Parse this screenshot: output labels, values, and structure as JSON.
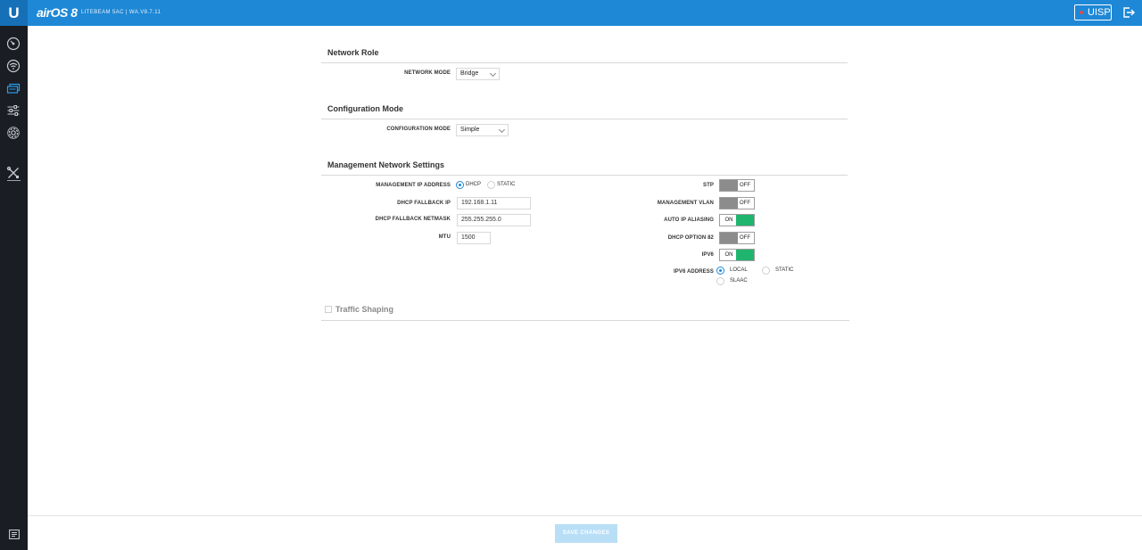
{
  "header": {
    "logo": "U",
    "brand": "airOS 8",
    "device": "LITEBEAM 5AC | WA.V8.7.11",
    "uisp_label": "UISP",
    "uisp_status_color": "#e24b4b",
    "accent": "#1e88d6"
  },
  "sidebar": {
    "items": [
      {
        "icon": "dashboard-icon"
      },
      {
        "icon": "wireless-icon"
      },
      {
        "icon": "network-icon",
        "active": true
      },
      {
        "icon": "services-icon"
      },
      {
        "icon": "system-icon"
      },
      {
        "icon": "tools-icon"
      }
    ],
    "footer_icon": "feedback-icon"
  },
  "network_role": {
    "title": "Network Role",
    "network_mode_label": "NETWORK MODE",
    "network_mode_value": "Bridge"
  },
  "configuration_mode": {
    "title": "Configuration Mode",
    "label": "CONFIGURATION MODE",
    "value": "Simple"
  },
  "management": {
    "title": "Management Network Settings",
    "ip_address_label": "MANAGEMENT IP ADDRESS",
    "ip_options": [
      "DHCP",
      "STATIC"
    ],
    "ip_selected": "DHCP",
    "fallback_ip_label": "DHCP FALLBACK IP",
    "fallback_ip_value": "192.168.1.11",
    "fallback_netmask_label": "DHCP FALLBACK NETMASK",
    "fallback_netmask_value": "255.255.255.0",
    "mtu_label": "MTU",
    "mtu_value": "1500",
    "stp_label": "STP",
    "stp_state": "OFF",
    "vlan_label": "MANAGEMENT VLAN",
    "vlan_state": "OFF",
    "aliasing_label": "AUTO IP ALIASING",
    "aliasing_state": "ON",
    "option82_label": "DHCP OPTION 82",
    "option82_state": "OFF",
    "ipv6_label": "IPV6",
    "ipv6_state": "ON",
    "ipv6_address_label": "IPV6 ADDRESS",
    "ipv6_options": [
      "LOCAL",
      "STATIC",
      "SLAAC"
    ],
    "ipv6_selected": "LOCAL"
  },
  "traffic_shaping": {
    "label": "Traffic Shaping",
    "checked": false
  },
  "footer": {
    "save_label": "SAVE CHANGES"
  }
}
